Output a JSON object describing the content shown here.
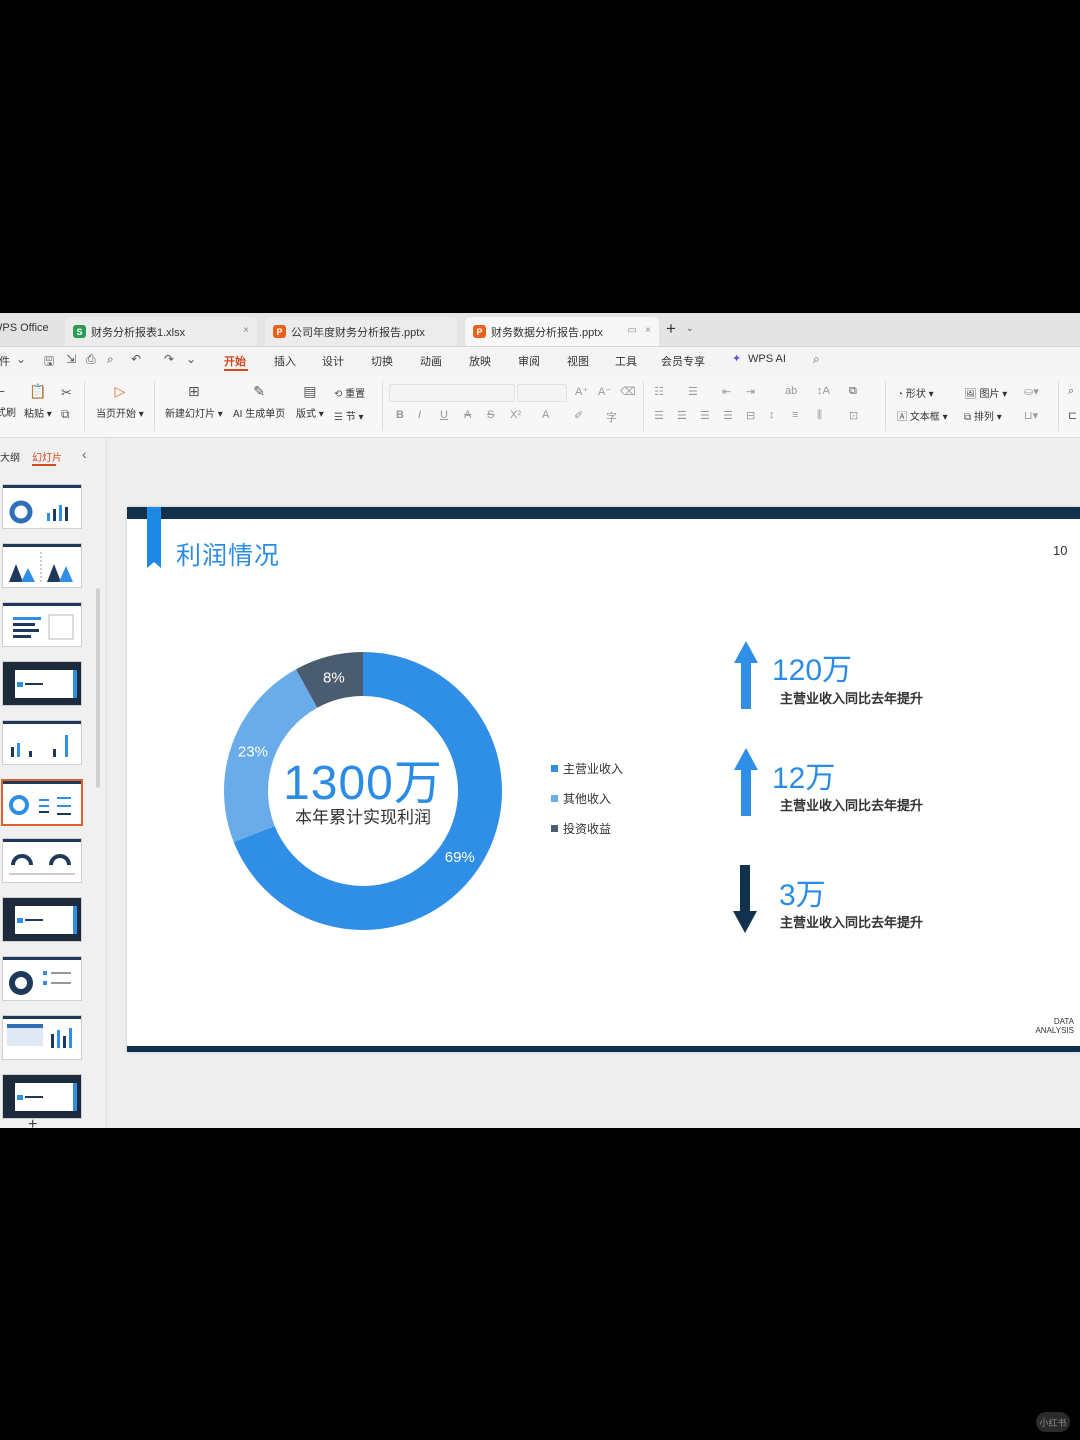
{
  "tabs": {
    "brand": "WPS Office",
    "items": [
      {
        "icon": "S",
        "icon_color": "#2a9d55",
        "label": "财务分析报表1.xlsx"
      },
      {
        "icon": "P",
        "icon_color": "#e8611c",
        "label": "公司年度财务分析报告.pptx"
      },
      {
        "icon": "P",
        "icon_color": "#e8611c",
        "label": "财务数据分析报告.pptx"
      }
    ],
    "close": "×",
    "new_tab": "+"
  },
  "menu": {
    "file": "文件",
    "items": [
      "开始",
      "插入",
      "设计",
      "切换",
      "动画",
      "放映",
      "审阅",
      "视图",
      "工具",
      "会员专享",
      "WPS AI"
    ]
  },
  "ribbon": {
    "format_painter": "格式刷",
    "paste": "粘贴",
    "play_from_current": "当页开始",
    "new_slide": "新建幻灯片",
    "ai_generate": "AI 生成单页",
    "layout": "版式",
    "reset": "重置",
    "section": "节",
    "shape": "形状",
    "picture": "图片",
    "textbox": "文本框",
    "arrange": "排列"
  },
  "panel": {
    "outline_tab": "大纲",
    "slides_tab": "幻灯片",
    "add": "+"
  },
  "slide": {
    "title": "利润情况",
    "page_number": "10",
    "center_value": "1300万",
    "center_label": "本年累计实现利润",
    "footer": [
      "DATA",
      "ANALYSIS"
    ],
    "metrics": [
      {
        "value": "120万",
        "desc": "主营业收入同比去年提升",
        "direction": "up"
      },
      {
        "value": "12万",
        "desc": "主营业收入同比去年提升",
        "direction": "up"
      },
      {
        "value": "3万",
        "desc": "主营业收入同比去年提升",
        "direction": "down"
      }
    ]
  },
  "chart_data": {
    "type": "pie",
    "categories": [
      "主营业收入",
      "其他收入",
      "投资收益"
    ],
    "values": [
      69,
      23,
      8
    ],
    "labels": [
      "69%",
      "23%",
      "8%"
    ],
    "colors": [
      "#2f8ee6",
      "#6aabea",
      "#4a5c70"
    ]
  },
  "watermark": "小红书"
}
